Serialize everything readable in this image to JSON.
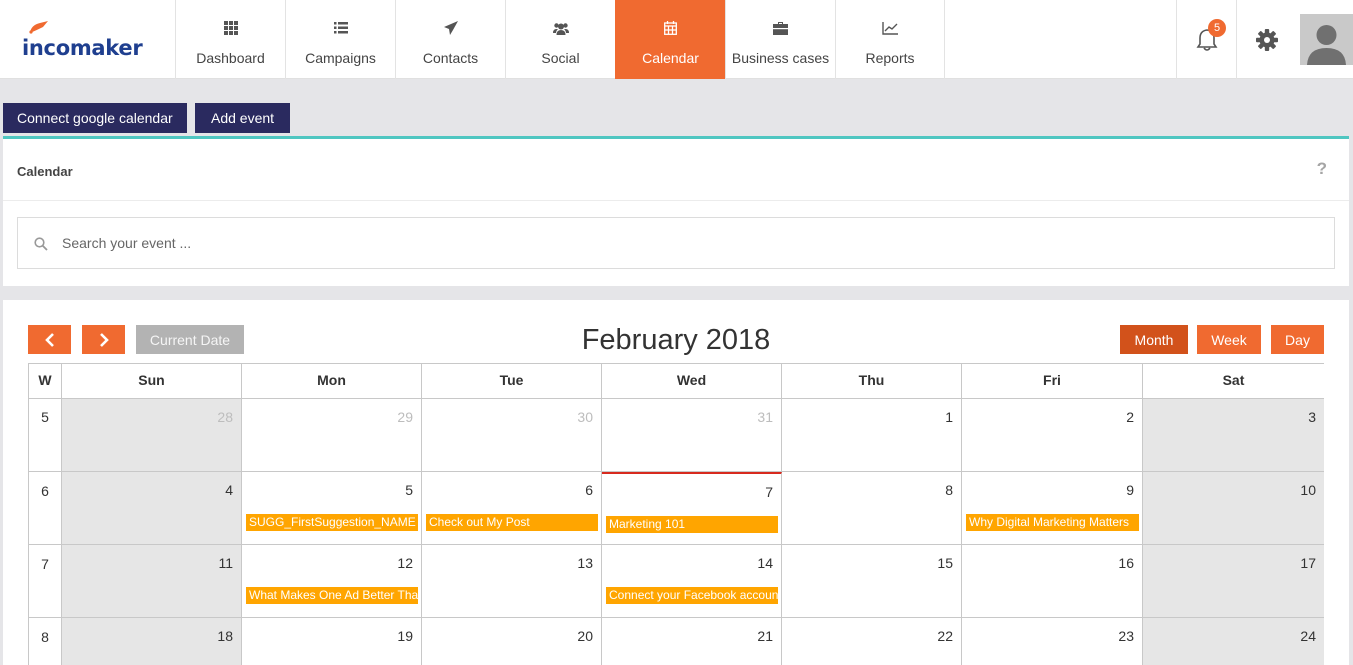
{
  "brand": {
    "name": "incomaker"
  },
  "nav": [
    {
      "label": "Dashboard",
      "icon": "dashboard-icon",
      "active": false
    },
    {
      "label": "Campaigns",
      "icon": "list-icon",
      "active": false
    },
    {
      "label": "Contacts",
      "icon": "paper-plane-icon",
      "active": false
    },
    {
      "label": "Social",
      "icon": "users-icon",
      "active": false
    },
    {
      "label": "Calendar",
      "icon": "calendar-icon",
      "active": true
    },
    {
      "label": "Business cases",
      "icon": "briefcase-icon",
      "active": false
    },
    {
      "label": "Reports",
      "icon": "line-chart-icon",
      "active": false
    }
  ],
  "notifications": {
    "count": "5"
  },
  "actions": {
    "connect_label": "Connect google calendar",
    "add_event_label": "Add event"
  },
  "calendar_panel": {
    "title": "Calendar",
    "help": "?"
  },
  "search": {
    "placeholder": "Search your event ..."
  },
  "calendar": {
    "title": "February 2018",
    "current_date_label": "Current Date",
    "view_buttons": [
      {
        "label": "Month",
        "active": true
      },
      {
        "label": "Week",
        "active": false
      },
      {
        "label": "Day",
        "active": false
      }
    ],
    "week_header": "W",
    "day_headers": [
      "Sun",
      "Mon",
      "Tue",
      "Wed",
      "Thu",
      "Fri",
      "Sat"
    ],
    "weeks": [
      {
        "week": "5",
        "days": [
          {
            "day": "28",
            "other": true,
            "events": []
          },
          {
            "day": "29",
            "other": true,
            "events": []
          },
          {
            "day": "30",
            "other": true,
            "events": []
          },
          {
            "day": "31",
            "other": true,
            "events": []
          },
          {
            "day": "1",
            "other": false,
            "events": []
          },
          {
            "day": "2",
            "other": false,
            "events": []
          },
          {
            "day": "3",
            "other": false,
            "events": []
          }
        ]
      },
      {
        "week": "6",
        "days": [
          {
            "day": "4",
            "other": false,
            "events": []
          },
          {
            "day": "5",
            "other": false,
            "events": [
              "SUGG_FirstSuggestion_NAME"
            ]
          },
          {
            "day": "6",
            "other": false,
            "events": [
              "Check out My Post"
            ]
          },
          {
            "day": "7",
            "other": false,
            "today": true,
            "events": [
              "Marketing 101"
            ]
          },
          {
            "day": "8",
            "other": false,
            "events": []
          },
          {
            "day": "9",
            "other": false,
            "events": [
              "Why Digital Marketing Matters"
            ]
          },
          {
            "day": "10",
            "other": false,
            "events": []
          }
        ]
      },
      {
        "week": "7",
        "days": [
          {
            "day": "11",
            "other": false,
            "events": []
          },
          {
            "day": "12",
            "other": false,
            "events": [
              "What Makes One Ad Better Tha"
            ]
          },
          {
            "day": "13",
            "other": false,
            "events": []
          },
          {
            "day": "14",
            "other": false,
            "events": [
              "Connect your Facebook accoun"
            ]
          },
          {
            "day": "15",
            "other": false,
            "events": []
          },
          {
            "day": "16",
            "other": false,
            "events": []
          },
          {
            "day": "17",
            "other": false,
            "events": []
          }
        ]
      },
      {
        "week": "8",
        "days": [
          {
            "day": "18",
            "other": false,
            "events": []
          },
          {
            "day": "19",
            "other": false,
            "events": []
          },
          {
            "day": "20",
            "other": false,
            "events": []
          },
          {
            "day": "21",
            "other": false,
            "events": []
          },
          {
            "day": "22",
            "other": false,
            "events": []
          },
          {
            "day": "23",
            "other": false,
            "events": []
          },
          {
            "day": "24",
            "other": false,
            "events": []
          }
        ]
      }
    ]
  },
  "colors": {
    "accent": "#f06a30",
    "dark_button": "#2a2a5f",
    "event": "#ffa500",
    "panel_border": "#4fc6c1",
    "today_line": "#d72a1e"
  }
}
